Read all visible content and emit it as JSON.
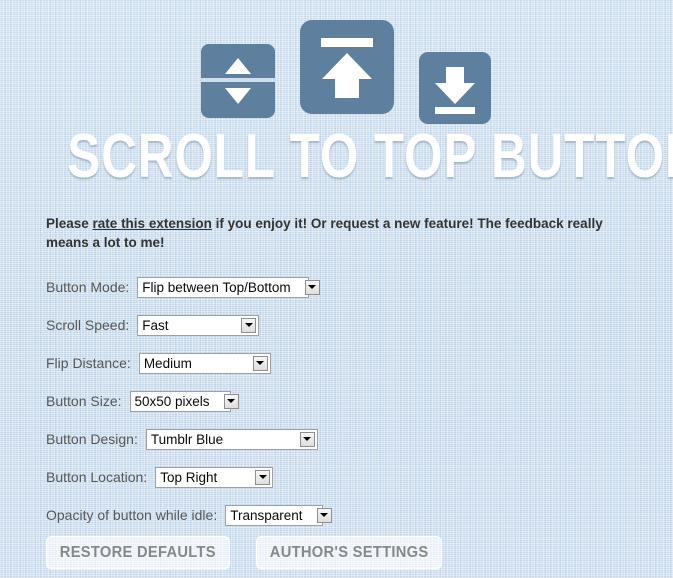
{
  "header": {
    "icons": [
      {
        "name": "flip-top-bottom-icon",
        "label": "Flip between top and bottom"
      },
      {
        "name": "scroll-to-top-icon",
        "label": "Scroll to top"
      },
      {
        "name": "scroll-to-bottom-icon",
        "label": "Scroll to bottom"
      }
    ],
    "title": "SCROLL TO TOP BUTTON"
  },
  "description": {
    "before_link": "Please ",
    "link": "rate this extension",
    "after_link": " if you enjoy it! Or request a new feature! The feedback really means a lot to me!"
  },
  "settings": [
    {
      "label": "Button Mode:",
      "value": "Flip between Top/Bottom",
      "name": "button-mode"
    },
    {
      "label": "Scroll Speed:",
      "value": "Fast",
      "name": "scroll-speed"
    },
    {
      "label": "Flip Distance:",
      "value": "Medium",
      "name": "flip-distance"
    },
    {
      "label": "Button Size:",
      "value": "50x50 pixels",
      "name": "button-size"
    },
    {
      "label": "Button Design:",
      "value": "Tumblr Blue",
      "name": "button-design"
    },
    {
      "label": "Button Location:",
      "value": "Top Right",
      "name": "button-location"
    },
    {
      "label": "Opacity of button while idle:",
      "value": "Transparent",
      "name": "button-opacity"
    }
  ],
  "buttons": {
    "restore_defaults": "RESTORE DEFAULTS",
    "authors_settings": "AUTHOR'S SETTINGS"
  },
  "colors": {
    "background": "#c9d9e8",
    "tile": "#5f7f9f",
    "title_text": "#ffffff",
    "label_text": "#575757",
    "description_text": "#333333",
    "button_text": "#888888"
  }
}
